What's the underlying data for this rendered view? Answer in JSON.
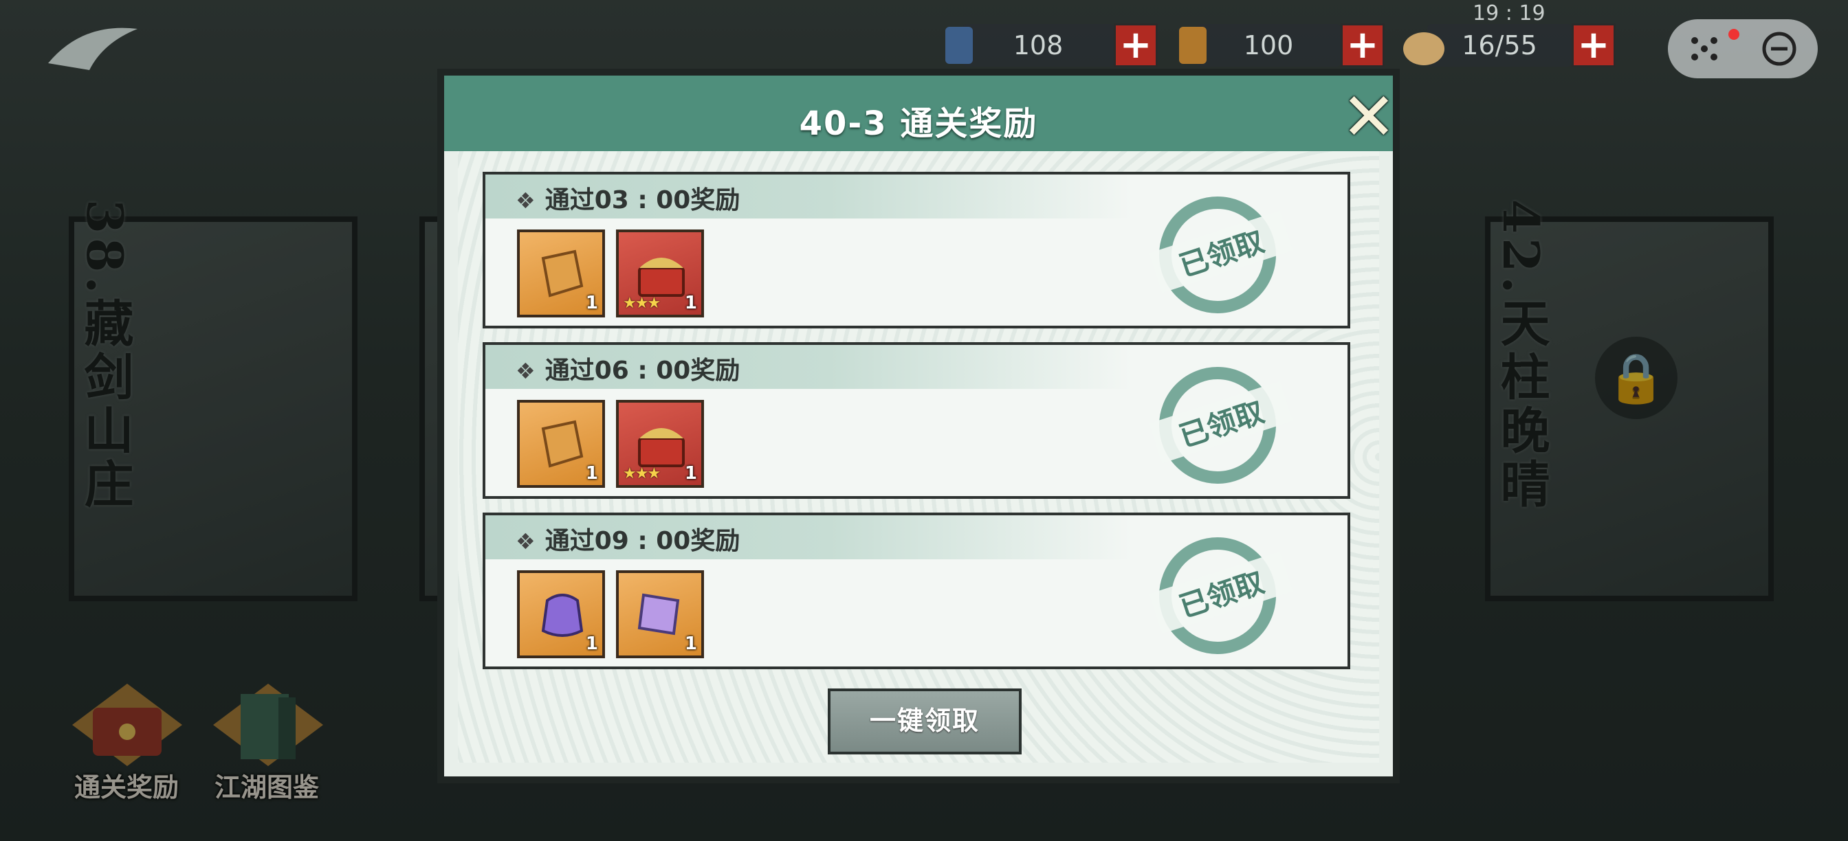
{
  "top_bar": {
    "clock": "19 : 19",
    "resources": [
      {
        "icon": "scroll-icon",
        "value": "108"
      },
      {
        "icon": "token-icon",
        "value": "100"
      },
      {
        "icon": "bun-icon",
        "value": "16/55"
      }
    ],
    "plus_label": "+"
  },
  "background": {
    "cards": [
      "38.藏剑山庄",
      "42.天柱晚晴"
    ],
    "bottom_buttons": [
      "通关奖励",
      "江湖图鉴"
    ]
  },
  "modal": {
    "title": "40-3 通关奖励",
    "close_label": "✕",
    "rows": [
      {
        "title": "通过03 : 00奖励",
        "status": "已领取",
        "items": [
          {
            "icon": "token-icon",
            "qty": "1",
            "stars": ""
          },
          {
            "icon": "treasure-chest-icon",
            "qty": "1",
            "stars": "★★★"
          }
        ]
      },
      {
        "title": "通过06 : 00奖励",
        "status": "已领取",
        "items": [
          {
            "icon": "token-icon",
            "qty": "1",
            "stars": ""
          },
          {
            "icon": "treasure-chest-icon",
            "qty": "1",
            "stars": "★★★"
          }
        ]
      },
      {
        "title": "通过09 : 00奖励",
        "status": "已领取",
        "items": [
          {
            "icon": "purple-pouch-icon",
            "qty": "1",
            "stars": ""
          },
          {
            "icon": "purple-scroll-icon",
            "qty": "1",
            "stars": ""
          }
        ]
      }
    ],
    "claim_all_label": "一键领取"
  },
  "colors": {
    "header": "#4f8f7c",
    "plus": "#b02a22",
    "stamp": "#4a7f6f"
  }
}
